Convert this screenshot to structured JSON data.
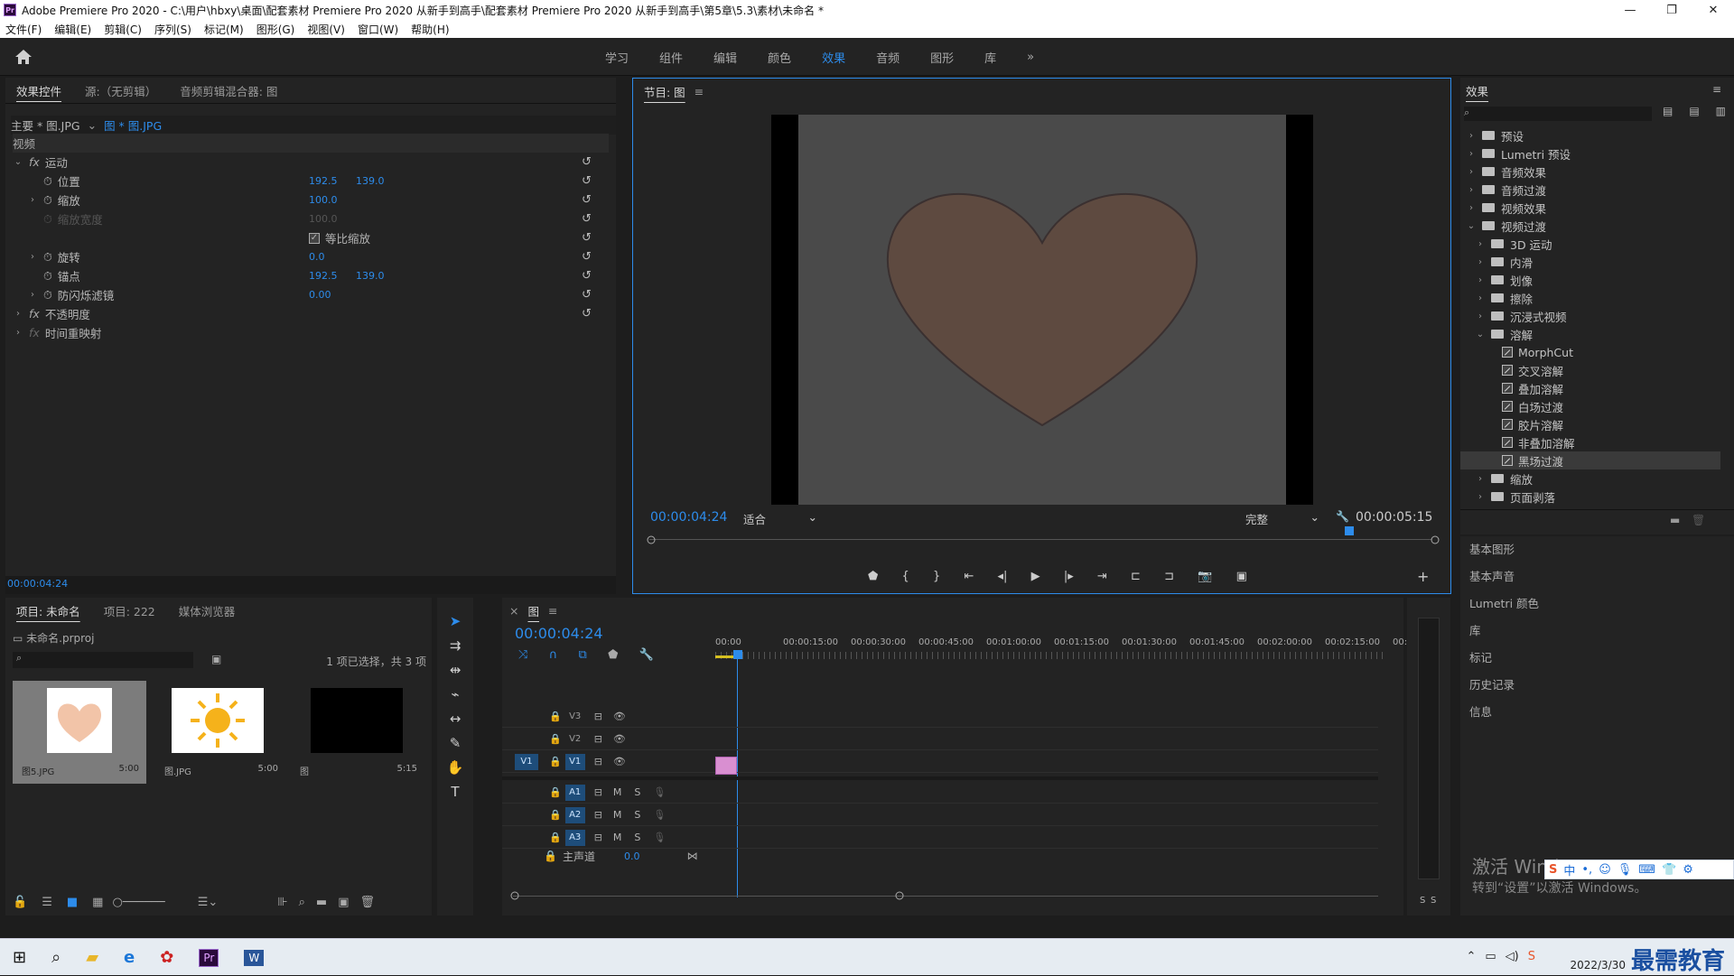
{
  "window": {
    "title": "Adobe Premiere Pro 2020 - C:\\用户\\hbxy\\桌面\\配套素材 Premiere Pro 2020 从新手到高手\\配套素材 Premiere Pro 2020 从新手到高手\\第5章\\5.3\\素材\\未命名 *",
    "min": "—",
    "max": "❐",
    "close": "✕"
  },
  "menu": [
    "文件(F)",
    "编辑(E)",
    "剪辑(C)",
    "序列(S)",
    "标记(M)",
    "图形(G)",
    "视图(V)",
    "窗口(W)",
    "帮助(H)"
  ],
  "workspaces": {
    "items": [
      "学习",
      "组件",
      "编辑",
      "颜色",
      "效果",
      "音频",
      "图形",
      "库"
    ],
    "active": "效果",
    "more": "»"
  },
  "effect_controls": {
    "tabs": [
      "效果控件",
      "源:（无剪辑）",
      "音频剪辑混合器: 图"
    ],
    "master": "主要 * 图.JPG",
    "clip": "图 * 图.JPG",
    "section_video": "视频",
    "motion": "运动",
    "props": [
      {
        "name": "位置",
        "v1": "192.5",
        "v2": "139.0"
      },
      {
        "name": "缩放",
        "v1": "100.0",
        "v2": ""
      },
      {
        "name": "缩放宽度",
        "v1": "100.0",
        "v2": ""
      },
      {
        "name": "等比缩放",
        "v1": "",
        "v2": ""
      },
      {
        "name": "旋转",
        "v1": "0.0",
        "v2": ""
      },
      {
        "name": "锚点",
        "v1": "192.5",
        "v2": "139.0"
      },
      {
        "name": "防闪烁滤镜",
        "v1": "0.00",
        "v2": ""
      }
    ],
    "opacity": "不透明度",
    "time_remap": "时间重映射",
    "timecode": "00:00:04:24"
  },
  "program": {
    "title": "节目: 图",
    "timecode": "00:00:04:24",
    "fit": "适合",
    "quality": "完整",
    "duration": "00:00:05:15",
    "colors": {
      "frame": "#4a4a4a",
      "heart": "#5e4a40",
      "heart_stroke": "#3a3030"
    }
  },
  "effects_panel": {
    "title": "效果",
    "tree": [
      {
        "label": "预设",
        "level": 0,
        "type": "folder",
        "open": false
      },
      {
        "label": "Lumetri 预设",
        "level": 0,
        "type": "folder",
        "open": false
      },
      {
        "label": "音频效果",
        "level": 0,
        "type": "folder",
        "open": false
      },
      {
        "label": "音频过渡",
        "level": 0,
        "type": "folder",
        "open": false
      },
      {
        "label": "视频效果",
        "level": 0,
        "type": "folder",
        "open": false
      },
      {
        "label": "视频过渡",
        "level": 0,
        "type": "folder",
        "open": true
      },
      {
        "label": "3D 运动",
        "level": 1,
        "type": "folder",
        "open": false
      },
      {
        "label": "内滑",
        "level": 1,
        "type": "folder",
        "open": false
      },
      {
        "label": "划像",
        "level": 1,
        "type": "folder",
        "open": false
      },
      {
        "label": "擦除",
        "level": 1,
        "type": "folder",
        "open": false
      },
      {
        "label": "沉浸式视频",
        "level": 1,
        "type": "folder",
        "open": false
      },
      {
        "label": "溶解",
        "level": 1,
        "type": "folder",
        "open": true
      },
      {
        "label": "MorphCut",
        "level": 2,
        "type": "fx"
      },
      {
        "label": "交叉溶解",
        "level": 2,
        "type": "fx"
      },
      {
        "label": "叠加溶解",
        "level": 2,
        "type": "fx"
      },
      {
        "label": "白场过渡",
        "level": 2,
        "type": "fx"
      },
      {
        "label": "胶片溶解",
        "level": 2,
        "type": "fx"
      },
      {
        "label": "非叠加溶解",
        "level": 2,
        "type": "fx"
      },
      {
        "label": "黑场过渡",
        "level": 2,
        "type": "fx",
        "selected": true
      },
      {
        "label": "缩放",
        "level": 1,
        "type": "folder",
        "open": false
      },
      {
        "label": "页面剥落",
        "level": 1,
        "type": "folder",
        "open": false
      }
    ],
    "side_panels": [
      "基本图形",
      "基本声音",
      "Lumetri 颜色",
      "库",
      "标记",
      "历史记录",
      "信息"
    ]
  },
  "project": {
    "tabs": [
      "项目: 未命名",
      "项目: 222",
      "媒体浏览器"
    ],
    "file": "未命名.prproj",
    "selection": "1 项已选择，共 3 项",
    "items": [
      {
        "name": "图5.JPG",
        "dur": "5:00",
        "kind": "heart"
      },
      {
        "name": "图.JPG",
        "dur": "5:00",
        "kind": "sun"
      },
      {
        "name": "图",
        "dur": "5:15",
        "kind": "seq"
      }
    ]
  },
  "timeline": {
    "tab": "图",
    "timecode": "00:00:04:24",
    "ruler": [
      "00:00",
      "00:00:15:00",
      "00:00:30:00",
      "00:00:45:00",
      "00:01:00:00",
      "00:01:15:00",
      "00:01:30:00",
      "00:01:45:00",
      "00:02:00:00",
      "00:02:15:00",
      "00:"
    ],
    "video_tracks": [
      "V3",
      "V2",
      "V1"
    ],
    "audio_tracks": [
      "A1",
      "A2",
      "A3"
    ],
    "src_v": "V1",
    "master": "主声道",
    "master_val": "0.0",
    "m": "M",
    "s": "S",
    "meter": [
      "S",
      "S"
    ]
  },
  "watermark": {
    "line1": "激活 Windows",
    "line2": "转到“设置”以激活 Windows。",
    "ime": "中"
  },
  "taskbar": {
    "date": "2022/3/30",
    "logo": "最需教育"
  }
}
